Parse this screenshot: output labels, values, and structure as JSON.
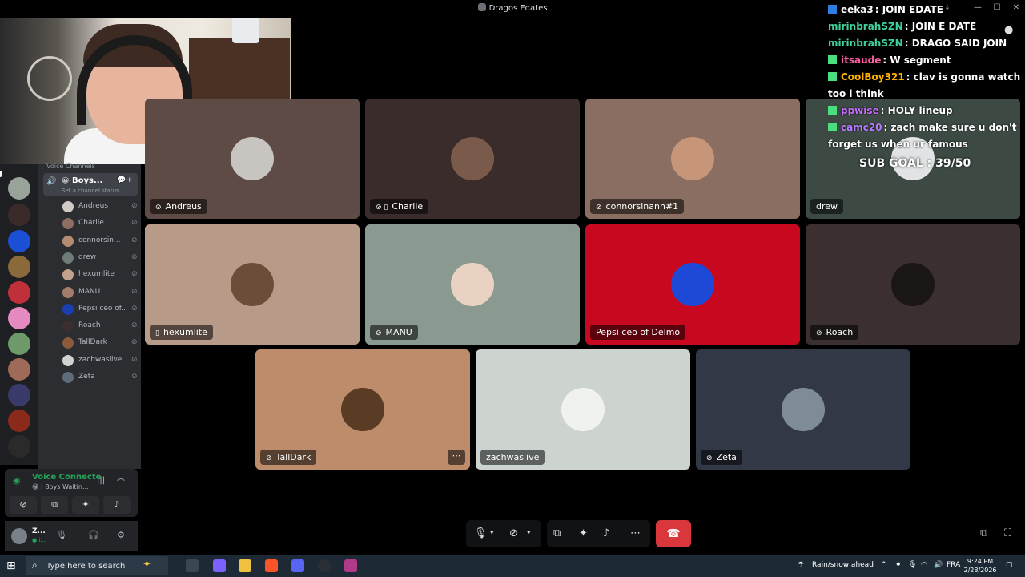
{
  "window": {
    "title": "Dragos Edates"
  },
  "window_controls": {
    "download": "⤓",
    "minimize": "—",
    "maximize": "☐",
    "close": "✕"
  },
  "sidebar": {
    "category": "Voice Channels",
    "channel": {
      "emoji": "😀",
      "name": "Boys...",
      "status": "Set a channel status"
    },
    "members": [
      {
        "name": "Andreus",
        "color": "#d0cbc6"
      },
      {
        "name": "Charlie",
        "color": "#8f6e62"
      },
      {
        "name": "connorsin...",
        "color": "#b58b71"
      },
      {
        "name": "drew",
        "color": "#6e7b77"
      },
      {
        "name": "hexumlite",
        "color": "#c3a18c"
      },
      {
        "name": "MANU",
        "color": "#a57c69"
      },
      {
        "name": "Pepsi ceo of...",
        "color": "#1a3fb0"
      },
      {
        "name": "Roach",
        "color": "#3b2e2e"
      },
      {
        "name": "TallDark",
        "color": "#8a5a3a"
      },
      {
        "name": "zachwaslive",
        "color": "#cfd4d1"
      },
      {
        "name": "Zeta",
        "color": "#5d6b7b"
      }
    ]
  },
  "voice_panel": {
    "title": "Voice Connecte",
    "subtitle": "😀 | Boys Waitin..."
  },
  "user_panel": {
    "name": "Z...",
    "sub": "● i..."
  },
  "tiles": [
    {
      "name": "Andreus",
      "bg": "#5e4b45",
      "avatar": "#c8c4c0"
    },
    {
      "name": "Charlie",
      "bg": "#3b2c2c",
      "avatar": "#7a5a4a"
    },
    {
      "name": "connorsinann#1",
      "bg": "#8a6e62",
      "avatar": "#c79679"
    },
    {
      "name": "drew",
      "bg": "#3d4a44",
      "avatar": "#e1e3e4"
    },
    {
      "name": "hexumlite",
      "bg": "#b89a89",
      "avatar": "#6b4d3a"
    },
    {
      "name": "MANU",
      "bg": "#8a9a90",
      "avatar": "#e9d2c2"
    },
    {
      "name": "Pepsi ceo of Delmo",
      "bg": "#c8081e",
      "avatar": "#1e49d6"
    },
    {
      "name": "Roach",
      "bg": "#3b2f2f",
      "avatar": "#1b1616"
    },
    {
      "name": "TallDark",
      "bg": "#bd8c6a",
      "avatar": "#5a3b24"
    },
    {
      "name": "zachwaslive",
      "bg": "#cdd4d0",
      "avatar": "#f0f2f0"
    },
    {
      "name": "Zeta",
      "bg": "#323845",
      "avatar": "#7f8b96"
    }
  ],
  "chat": [
    {
      "user": "eeka3",
      "user_color": "#ffffff",
      "badge_color": "#2f7de1",
      "text": ": JOIN EDATE"
    },
    {
      "user": "mirinbrahSZN",
      "user_color": "#3fd29a",
      "badge_color": "",
      "text": ": JOIN E DATE"
    },
    {
      "user": "mirinbrahSZN",
      "user_color": "#3fd29a",
      "badge_color": "",
      "text": ": DRAGO SAID JOIN"
    },
    {
      "user": "itsaude",
      "user_color": "#ff5fa2",
      "badge_color": "#4ade80",
      "text": ": W segment"
    },
    {
      "user": "CoolBoy321",
      "user_color": "#ffb000",
      "badge_color": "#4ade80",
      "text": ": clav is gonna watch too i think"
    },
    {
      "user": "ppwise",
      "user_color": "#c86bff",
      "badge_color": "#4ade80",
      "text": ": HOLY lineup"
    },
    {
      "user": "camc20",
      "user_color": "#b37bff",
      "badge_color": "#4ade80",
      "text": ": zach make sure u don't forget us when ur famous"
    }
  ],
  "sub_goal": "SUB GOAL : 39/50",
  "taskbar": {
    "search_placeholder": "Type here to search",
    "weather": "Rain/snow ahead",
    "language": "FRA",
    "time": "9:24 PM",
    "date": "2/28/2026"
  },
  "colors": {
    "accent_green": "#23a559",
    "hangup_red": "#da373c"
  }
}
